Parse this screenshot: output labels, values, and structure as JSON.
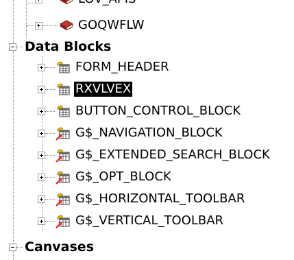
{
  "tree": {
    "top_partial_label": "LOV_APIS",
    "items": [
      {
        "label": "GOQWFLW",
        "kind": "program-unit"
      },
      {
        "label": "Data Blocks",
        "kind": "category"
      },
      {
        "label": "FORM_HEADER",
        "kind": "block"
      },
      {
        "label": "RXVLVEX",
        "kind": "block",
        "selected": true
      },
      {
        "label": "BUTTON_CONTROL_BLOCK",
        "kind": "block"
      },
      {
        "label": "G$_NAVIGATION_BLOCK",
        "kind": "subclassed-block"
      },
      {
        "label": "G$_EXTENDED_SEARCH_BLOCK",
        "kind": "subclassed-block"
      },
      {
        "label": "G$_OPT_BLOCK",
        "kind": "subclassed-block"
      },
      {
        "label": "G$_HORIZONTAL_TOOLBAR",
        "kind": "subclassed-block"
      },
      {
        "label": "G$_VERTICAL_TOOLBAR",
        "kind": "subclassed-block"
      },
      {
        "label": "Canvases",
        "kind": "category"
      }
    ],
    "colors": {
      "selection_bg": "#000000",
      "selection_fg": "#ffffff",
      "connector": "#8a8a8a",
      "block_icon": "#f2c200",
      "subclass_arrow": "#e02020",
      "program_unit_icon": "#a0132a"
    }
  }
}
